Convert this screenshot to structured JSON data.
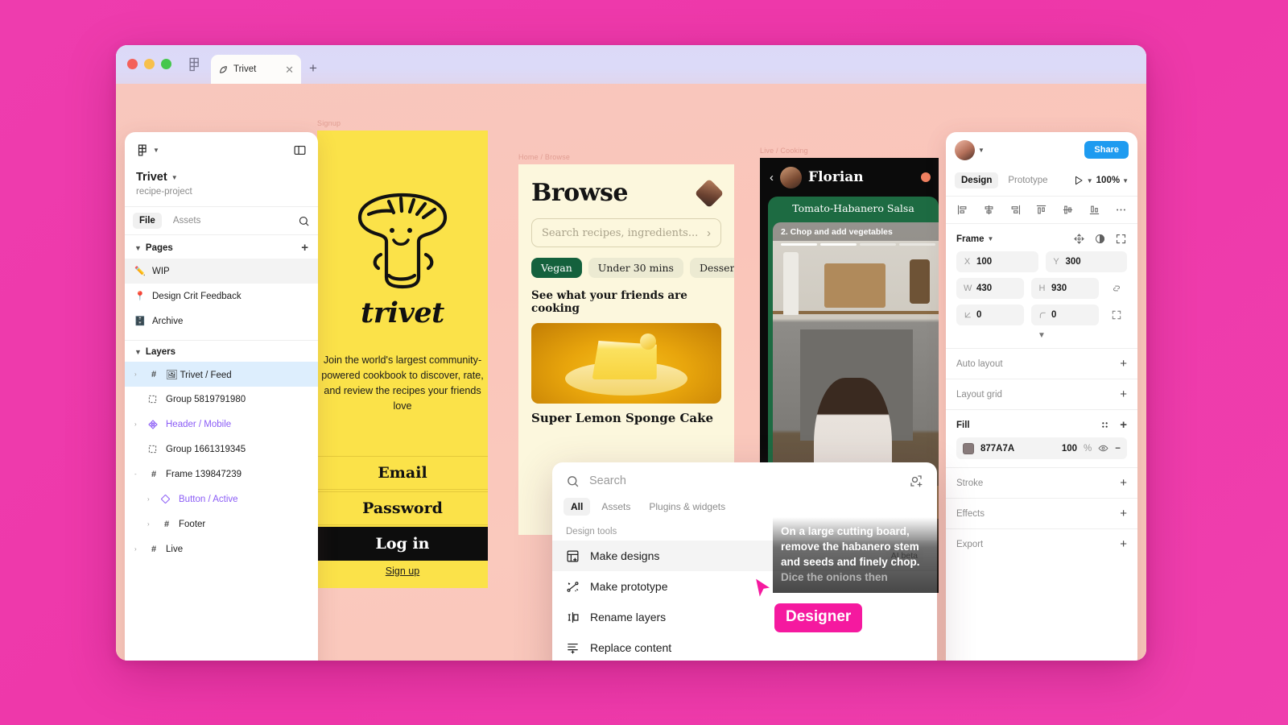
{
  "window": {
    "tab": {
      "label": "Trivet",
      "close_icon": "close-icon",
      "new_tab_icon": "plus-icon"
    }
  },
  "left_panel": {
    "file_name": "Trivet",
    "project": "recipe-project",
    "tabs": [
      {
        "label": "File",
        "active": true
      },
      {
        "label": "Assets",
        "active": false
      }
    ],
    "search_icon": "search-icon",
    "sidebar_toggle_icon": "panel-toggle-icon",
    "pages_section": {
      "label": "Pages",
      "add_label": "+"
    },
    "pages": [
      {
        "emoji": "✏️",
        "label": "WIP",
        "selected": true
      },
      {
        "emoji": "📍",
        "label": "Design Crit Feedback",
        "selected": false
      },
      {
        "emoji": "🗄️",
        "label": "Archive",
        "selected": false
      }
    ],
    "layers_section": {
      "label": "Layers"
    },
    "layers": [
      {
        "label": "🖼 Trivet / Feed",
        "type": "frame",
        "indent": 0,
        "twisty": "›",
        "selected": true,
        "purple": false
      },
      {
        "label": "Group 5819791980",
        "type": "group",
        "indent": 0,
        "twisty": "",
        "selected": false,
        "purple": false
      },
      {
        "label": "Header / Mobile",
        "type": "component",
        "indent": 0,
        "twisty": "›",
        "selected": false,
        "purple": true
      },
      {
        "label": "Group 1661319345",
        "type": "group",
        "indent": 0,
        "twisty": "",
        "selected": false,
        "purple": false
      },
      {
        "label": "Frame 139847239",
        "type": "frame",
        "indent": 0,
        "twisty": "-",
        "selected": false,
        "purple": false
      },
      {
        "label": "Button / Active",
        "type": "instance",
        "indent": 1,
        "twisty": "›",
        "selected": false,
        "purple": true
      },
      {
        "label": "Footer",
        "type": "frame",
        "indent": 1,
        "twisty": "›",
        "selected": false,
        "purple": false
      },
      {
        "label": "Live",
        "type": "frame",
        "indent": 0,
        "twisty": "›",
        "selected": false,
        "purple": false
      }
    ]
  },
  "right_panel": {
    "avatar_icon": "avatar",
    "share_label": "Share",
    "tabs": [
      {
        "label": "Design",
        "active": true
      },
      {
        "label": "Prototype",
        "active": false
      }
    ],
    "present_icon": "play-icon",
    "zoom": "100%",
    "align_icons": [
      "align-left-icon",
      "align-horizontal-center-icon",
      "align-right-icon",
      "align-top-icon",
      "align-vertical-center-icon",
      "align-bottom-icon",
      "more-options-icon"
    ],
    "section": {
      "title": "Frame",
      "icons": [
        "constraints-icon",
        "opacity-icon",
        "fullscreen-icon"
      ]
    },
    "fields": [
      {
        "label": "X",
        "value": "100"
      },
      {
        "label": "Y",
        "value": "300"
      },
      {
        "label": "W",
        "value": "430"
      },
      {
        "label": "H",
        "value": "930"
      }
    ],
    "link_icon": "proportion-link-icon",
    "rotation": {
      "label": "rotation",
      "value": "0"
    },
    "corner_radius": {
      "label": "corner-radius",
      "value": "0"
    },
    "independent_corners_icon": "independent-corners-icon",
    "expand_icon": "chevron-down-icon",
    "properties": [
      {
        "label": "Auto layout",
        "action": "+"
      },
      {
        "label": "Layout grid",
        "action": "+"
      }
    ],
    "fill": {
      "label": "Fill",
      "style_icon": "styles-icon",
      "add": "+",
      "color_hex": "877A7A",
      "swatch_color": "#877A7A",
      "opacity": "100",
      "opacity_unit": "%",
      "visibility_icon": "eye-icon",
      "remove": "−"
    },
    "properties_after": [
      {
        "label": "Stroke",
        "action": "+"
      },
      {
        "label": "Effects",
        "action": "+"
      },
      {
        "label": "Export",
        "action": "+"
      }
    ],
    "help_label": "?"
  },
  "search_popup": {
    "placeholder": "Search",
    "search_icon": "search-icon",
    "scan_icon": "scan-add-icon",
    "tabs": [
      {
        "label": "All",
        "active": true
      },
      {
        "label": "Assets",
        "active": false
      },
      {
        "label": "Plugins & widgets",
        "active": false
      }
    ],
    "group_label": "Design tools",
    "items": [
      {
        "label": "Make designs",
        "icon": "make-designs-icon",
        "badge": "AI beta",
        "highlighted": true
      },
      {
        "label": "Make prototype",
        "icon": "make-prototype-icon",
        "badge": "",
        "highlighted": false
      },
      {
        "label": "Rename layers",
        "icon": "rename-layers-icon",
        "badge": "",
        "highlighted": false
      },
      {
        "label": "Replace content",
        "icon": "replace-content-icon",
        "badge": "",
        "highlighted": false
      }
    ]
  },
  "cursor": {
    "label": "Designer",
    "color": "#f5199f"
  },
  "toolbar": {
    "tools": [
      {
        "icon": "move-tool-icon",
        "active": true,
        "caret": true
      },
      {
        "icon": "frame-tool-icon",
        "active": false,
        "caret": true
      },
      {
        "icon": "shape-tool-icon",
        "active": false,
        "caret": true
      },
      {
        "icon": "pen-tool-icon",
        "active": false,
        "caret": true
      },
      {
        "icon": "text-tool-icon",
        "active": false,
        "caret": false
      },
      {
        "icon": "comment-tool-icon",
        "active": false,
        "caret": false
      },
      {
        "icon": "actions-ai-icon",
        "active": true,
        "caret": false
      }
    ],
    "dev_mode_icon": "code-icon"
  },
  "canvas": {
    "signup_frame": {
      "brand": "trivet",
      "tagline": "Join the world's largest community-powered cookbook to discover, rate, and review the recipes your friends love",
      "email_label": "Email",
      "password_label": "Password",
      "login_label": "Log in",
      "signup_label": "Sign up"
    },
    "browse_frame": {
      "title": "Browse",
      "search_placeholder": "Search recipes, ingredients...",
      "chips": [
        {
          "label": "Vegan",
          "active": true
        },
        {
          "label": "Under 30 mins",
          "active": false
        },
        {
          "label": "Desserts",
          "active": false
        }
      ],
      "section_title": "See what your friends are cooking",
      "card_title": "Super Lemon Sponge Cake"
    },
    "video_frame": {
      "back_icon": "chevron-left-icon",
      "author": "Florian",
      "dish": "Tomato-Habanero Salsa",
      "step": "2.  Chop and add vegetables",
      "caption_line1": "On a large cutting board, remove the habanero stem and seeds and finely chop.",
      "caption_line2": "Dice the onions then"
    }
  }
}
